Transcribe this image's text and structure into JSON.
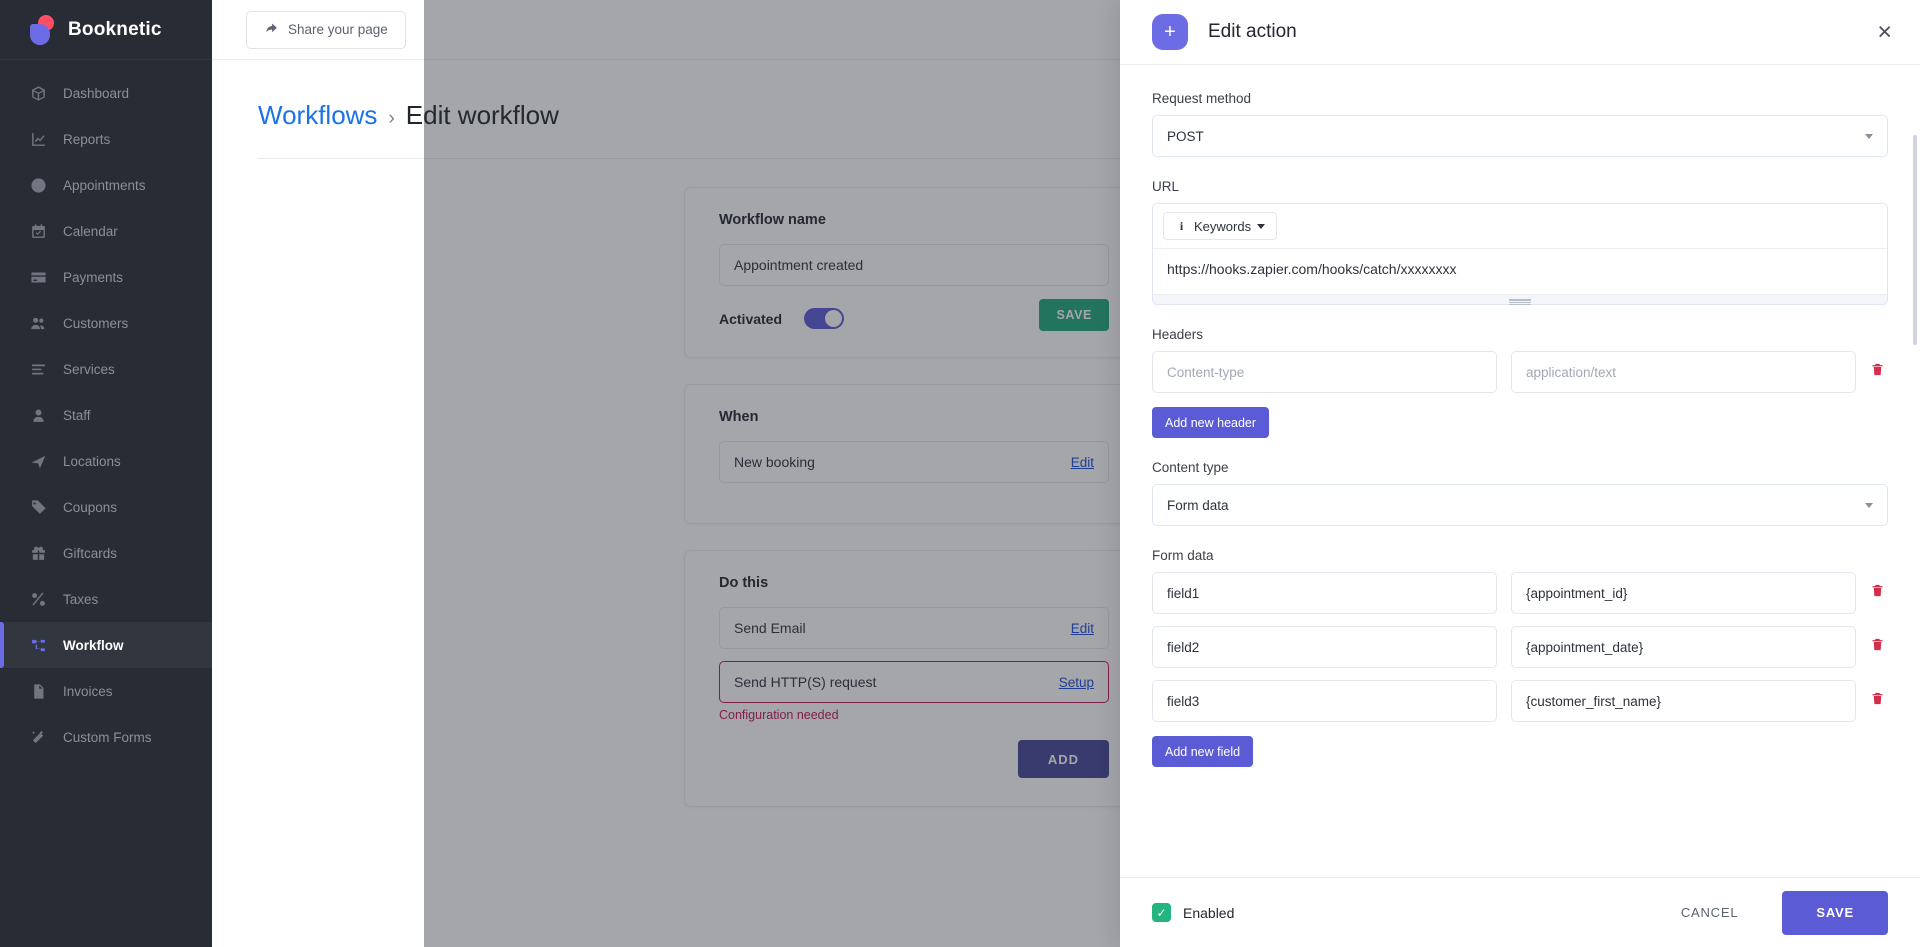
{
  "brand": {
    "name": "Booknetic"
  },
  "sidebar": {
    "items": [
      {
        "label": "Dashboard",
        "icon": "box-icon",
        "active": false
      },
      {
        "label": "Reports",
        "icon": "chart-icon",
        "active": false
      },
      {
        "label": "Appointments",
        "icon": "clock-icon",
        "active": false
      },
      {
        "label": "Calendar",
        "icon": "calendar-icon",
        "active": false
      },
      {
        "label": "Payments",
        "icon": "card-icon",
        "active": false
      },
      {
        "label": "Customers",
        "icon": "users-icon",
        "active": false
      },
      {
        "label": "Services",
        "icon": "list-icon",
        "active": false
      },
      {
        "label": "Staff",
        "icon": "person-icon",
        "active": false
      },
      {
        "label": "Locations",
        "icon": "send-icon",
        "active": false
      },
      {
        "label": "Coupons",
        "icon": "tag-icon",
        "active": false
      },
      {
        "label": "Giftcards",
        "icon": "gift-icon",
        "active": false
      },
      {
        "label": "Taxes",
        "icon": "percent-icon",
        "active": false
      },
      {
        "label": "Workflow",
        "icon": "workflow-icon",
        "active": true
      },
      {
        "label": "Invoices",
        "icon": "document-icon",
        "active": false
      },
      {
        "label": "Custom Forms",
        "icon": "wand-icon",
        "active": false
      }
    ]
  },
  "topbar": {
    "share_label": "Share your page"
  },
  "breadcrumb": {
    "root": "Workflows",
    "separator": "›",
    "current": "Edit workflow"
  },
  "workflow": {
    "name_label": "Workflow name",
    "name_value": "Appointment created",
    "activated_label": "Activated",
    "save_label": "SAVE",
    "when_title": "When",
    "when_item": "New booking",
    "when_edit": "Edit",
    "do_title": "Do this",
    "actions": [
      {
        "name": "Send Email",
        "link": "Edit",
        "error": false,
        "error_text": ""
      },
      {
        "name": "Send HTTP(S) request",
        "link": "Setup",
        "error": true,
        "error_text": "Configuration needed"
      }
    ],
    "add_label": "ADD"
  },
  "modal": {
    "title": "Edit action",
    "plus_icon": "plus-icon",
    "close_icon": "close-icon",
    "request_method_label": "Request method",
    "request_method_value": "POST",
    "url_label": "URL",
    "keywords_label": "Keywords",
    "url_value": "https://hooks.zapier.com/hooks/catch/xxxxxxxx",
    "headers_label": "Headers",
    "headers": [
      {
        "key_placeholder": "Content-type",
        "value_placeholder": "application/text"
      }
    ],
    "add_header_label": "Add new header",
    "content_type_label": "Content type",
    "content_type_value": "Form data",
    "form_data_label": "Form data",
    "form_fields": [
      {
        "key": "field1",
        "value": "{appointment_id}"
      },
      {
        "key": "field2",
        "value": "{appointment_date}"
      },
      {
        "key": "field3",
        "value": "{customer_first_name}"
      }
    ],
    "add_field_label": "Add new field",
    "enabled_label": "Enabled",
    "cancel_label": "CANCEL",
    "save_label": "SAVE"
  },
  "colors": {
    "accent": "#6c6ce5",
    "sidebar_bg": "#282c35",
    "error": "#c2185b",
    "success": "#1fa97c",
    "link": "#1a73e8"
  }
}
